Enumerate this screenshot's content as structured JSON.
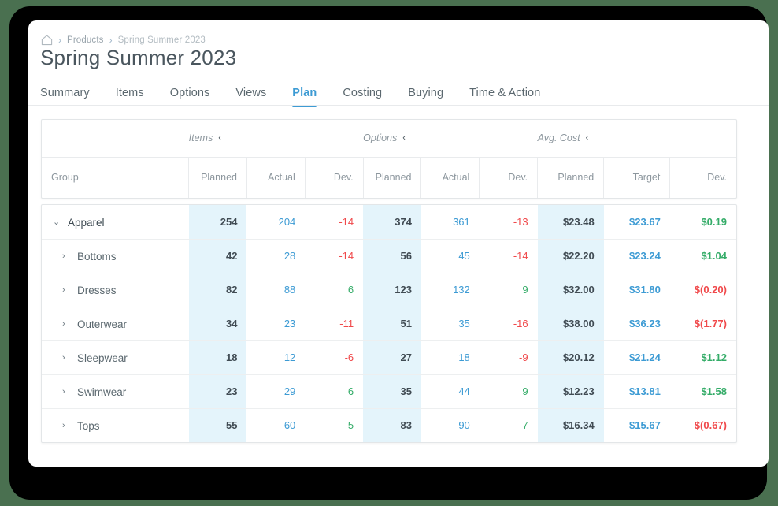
{
  "breadcrumb": {
    "home_icon": "home-icon",
    "separator": "›",
    "items": [
      "Products",
      "Spring Summer 2023"
    ]
  },
  "page_title": "Spring Summer 2023",
  "tabs": [
    {
      "label": "Summary",
      "active": false
    },
    {
      "label": "Items",
      "active": false
    },
    {
      "label": "Options",
      "active": false
    },
    {
      "label": "Views",
      "active": false
    },
    {
      "label": "Plan",
      "active": true
    },
    {
      "label": "Costing",
      "active": false
    },
    {
      "label": "Buying",
      "active": false
    },
    {
      "label": "Time & Action",
      "active": false
    }
  ],
  "table": {
    "group_headers": [
      {
        "label": "Items",
        "collapse_icon": "‹"
      },
      {
        "label": "Options",
        "collapse_icon": "‹"
      },
      {
        "label": "Avg. Cost",
        "collapse_icon": "‹"
      }
    ],
    "columns": {
      "group": "Group",
      "items": [
        "Planned",
        "Actual",
        "Dev."
      ],
      "options": [
        "Planned",
        "Actual",
        "Dev."
      ],
      "cost": [
        "Planned",
        "Target",
        "Dev."
      ]
    },
    "rows": [
      {
        "label": "Apparel",
        "level": 0,
        "expanded": true,
        "caret": "⌄",
        "items": {
          "planned": "254",
          "actual": "204",
          "dev": "-14",
          "dev_sign": "neg"
        },
        "options": {
          "planned": "374",
          "actual": "361",
          "dev": "-13",
          "dev_sign": "neg"
        },
        "cost": {
          "planned": "$23.48",
          "target": "$23.67",
          "dev": "$0.19",
          "dev_sign": "pos"
        }
      },
      {
        "label": "Bottoms",
        "level": 1,
        "expanded": false,
        "caret": "›",
        "items": {
          "planned": "42",
          "actual": "28",
          "dev": "-14",
          "dev_sign": "neg"
        },
        "options": {
          "planned": "56",
          "actual": "45",
          "dev": "-14",
          "dev_sign": "neg"
        },
        "cost": {
          "planned": "$22.20",
          "target": "$23.24",
          "dev": "$1.04",
          "dev_sign": "pos"
        }
      },
      {
        "label": "Dresses",
        "level": 1,
        "expanded": false,
        "caret": "›",
        "items": {
          "planned": "82",
          "actual": "88",
          "dev": "6",
          "dev_sign": "pos"
        },
        "options": {
          "planned": "123",
          "actual": "132",
          "dev": "9",
          "dev_sign": "pos"
        },
        "cost": {
          "planned": "$32.00",
          "target": "$31.80",
          "dev": "$(0.20)",
          "dev_sign": "neg"
        }
      },
      {
        "label": "Outerwear",
        "level": 1,
        "expanded": false,
        "caret": "›",
        "items": {
          "planned": "34",
          "actual": "23",
          "dev": "-11",
          "dev_sign": "neg"
        },
        "options": {
          "planned": "51",
          "actual": "35",
          "dev": "-16",
          "dev_sign": "neg"
        },
        "cost": {
          "planned": "$38.00",
          "target": "$36.23",
          "dev": "$(1.77)",
          "dev_sign": "neg"
        }
      },
      {
        "label": "Sleepwear",
        "level": 1,
        "expanded": false,
        "caret": "›",
        "items": {
          "planned": "18",
          "actual": "12",
          "dev": "-6",
          "dev_sign": "neg"
        },
        "options": {
          "planned": "27",
          "actual": "18",
          "dev": "-9",
          "dev_sign": "neg"
        },
        "cost": {
          "planned": "$20.12",
          "target": "$21.24",
          "dev": "$1.12",
          "dev_sign": "pos"
        }
      },
      {
        "label": "Swimwear",
        "level": 1,
        "expanded": false,
        "caret": "›",
        "items": {
          "planned": "23",
          "actual": "29",
          "dev": "6",
          "dev_sign": "pos"
        },
        "options": {
          "planned": "35",
          "actual": "44",
          "dev": "9",
          "dev_sign": "pos"
        },
        "cost": {
          "planned": "$12.23",
          "target": "$13.81",
          "dev": "$1.58",
          "dev_sign": "pos"
        }
      },
      {
        "label": "Tops",
        "level": 1,
        "expanded": false,
        "caret": "›",
        "items": {
          "planned": "55",
          "actual": "60",
          "dev": "5",
          "dev_sign": "pos"
        },
        "options": {
          "planned": "83",
          "actual": "90",
          "dev": "7",
          "dev_sign": "pos"
        },
        "cost": {
          "planned": "$16.34",
          "target": "$15.67",
          "dev": "$(0.67)",
          "dev_sign": "neg"
        }
      }
    ]
  },
  "colors": {
    "accent": "#3d9bd4",
    "positive": "#34ac68",
    "negative": "#f0494b",
    "highlight_column": "#e4f4fb",
    "page_background": "#4a7050"
  }
}
